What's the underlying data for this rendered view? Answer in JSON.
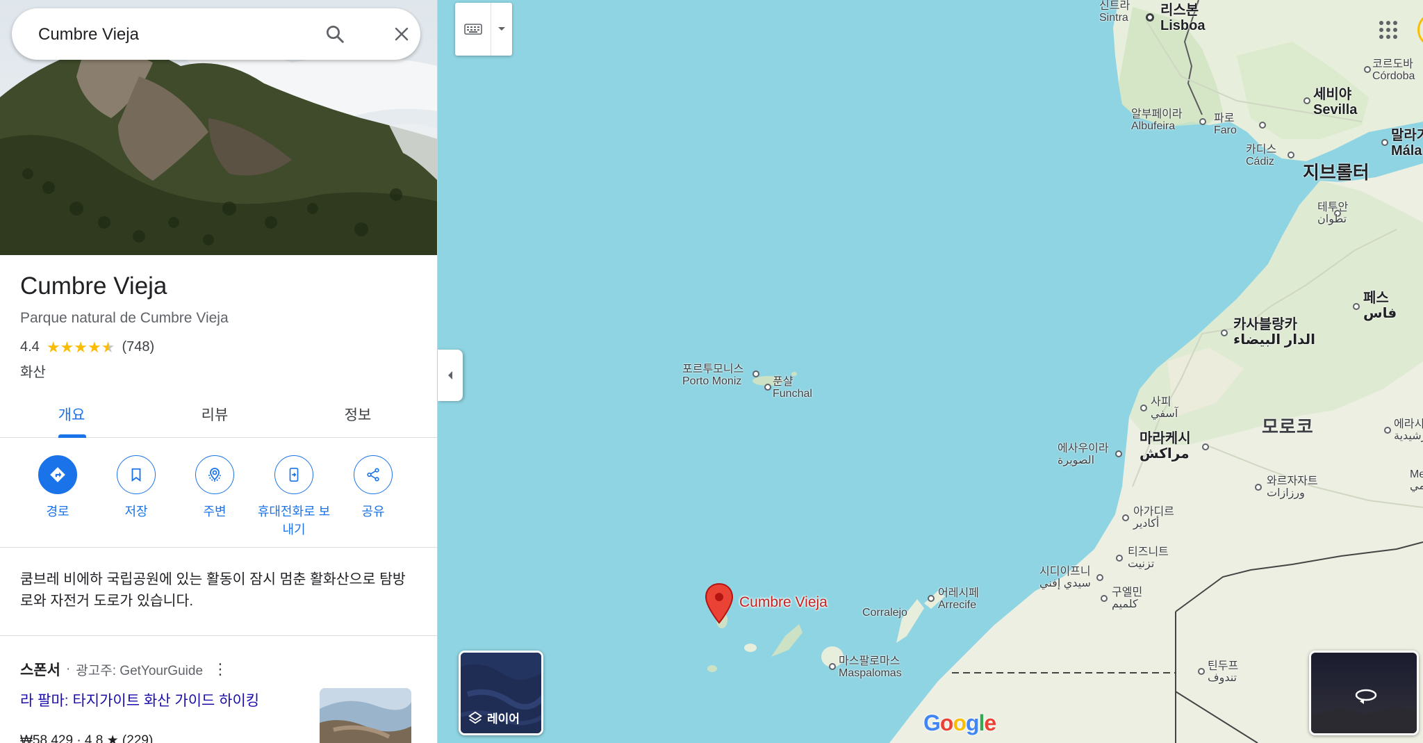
{
  "search": {
    "value": "Cumbre Vieja"
  },
  "place": {
    "title": "Cumbre Vieja",
    "subtitle": "Parque natural de Cumbre Vieja",
    "rating": "4.4",
    "review_count": "(748)",
    "stars": 4.4,
    "category": "화산"
  },
  "tabs": [
    {
      "label": "개요",
      "active": true
    },
    {
      "label": "리뷰",
      "active": false
    },
    {
      "label": "정보",
      "active": false
    }
  ],
  "actions": [
    {
      "label": "경로",
      "icon": "directions-icon"
    },
    {
      "label": "저장",
      "icon": "bookmark-icon"
    },
    {
      "label": "주변",
      "icon": "nearby-icon"
    },
    {
      "label": "휴대전화로 보\n내기",
      "icon": "send-to-phone-icon"
    },
    {
      "label": "공유",
      "icon": "share-icon"
    }
  ],
  "description": "쿰브레 비에하 국립공원에 있는 활동이 잠시 멈춘 활화산으로 탐방로와 자전거 도로가 있습니다.",
  "sponsor": {
    "label": "스폰서",
    "separator": "·",
    "advertiser": "광고주: GetYourGuide",
    "ad_title": "라 팔마: 타지가이트 화산 가이드 하이킹",
    "price_line": "₩58,429 · 4.8 ★ (229)"
  },
  "map": {
    "marker_label": "Cumbre Vieja",
    "layer_label": "레이어",
    "logo": "Google",
    "labels": {
      "sintra": "신트라\nSintra",
      "lisboa": "리스본\nLisboa",
      "cordoba": "코르도바\nCórdoba",
      "sevilla": "세비야\nSevilla",
      "albufeira": "알부페이라\nAlbufeira",
      "faro": "파로\nFaro",
      "malaga": "말라가\nMála",
      "cadiz": "카디스\nCádiz",
      "gibraltar": "지브롤터",
      "tetouan": "테투안\nتطوان",
      "fes": "페스\nفاس",
      "casablanca": "카사블랑카\nالدار البيضاء",
      "safi": "사피\nآسفي",
      "marrakech": "마라케시\nمراكش",
      "essaouira": "에사우이라\nالصويرة",
      "morocco": "모로코",
      "errachidia": "에라시\nالرشيدية",
      "ouarzazate": "와르자자트\nورزازات",
      "agadir": "아가디르\nأكادير",
      "tiznit": "티즈니트\nتزنيت",
      "sidi_ifni": "시디이프니\nسيدي إفني",
      "guelmim": "구엘민\nكلميم",
      "tindouf": "틴두프\nتندوف",
      "porto_moniz": "포르투모니스\nPorto Moniz",
      "funchal": "푼샬\nFunchal",
      "arrecife": "어레시페\nArrecife",
      "corralejo": "Corralejo",
      "maspalomas": "마스팔로마스\nMaspalomas",
      "me": "Me\nمي"
    }
  },
  "colors": {
    "accent": "#1a73e8",
    "ocean": "#8fd4e2",
    "land": "#e7ecdd",
    "marker": "#ea4335",
    "star": "#fbbc04"
  }
}
